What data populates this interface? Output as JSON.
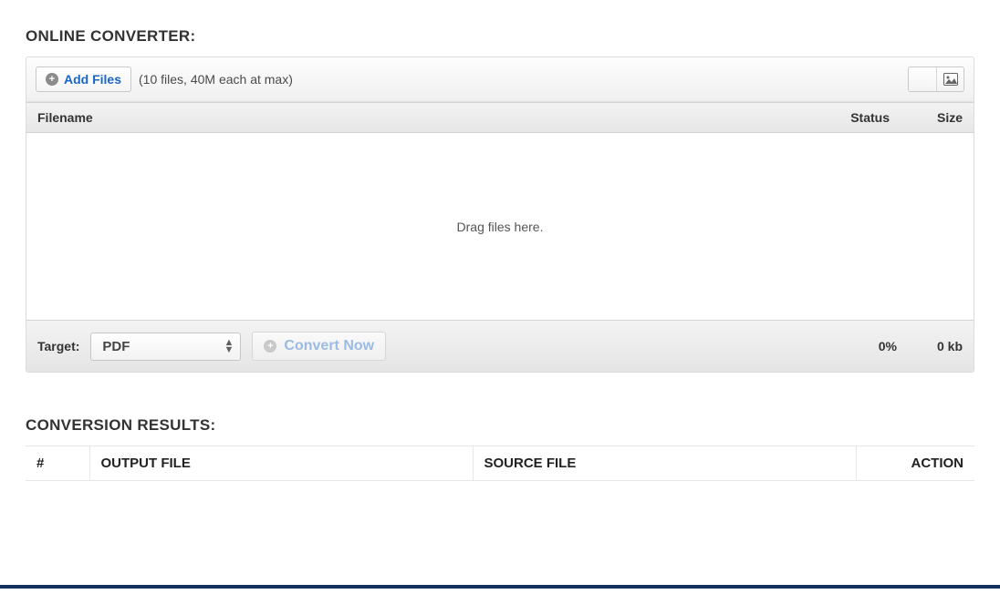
{
  "converter": {
    "title": "ONLINE CONVERTER:",
    "addFilesLabel": "Add Files",
    "limits": "(10 files, 40M each at max)",
    "columns": {
      "filename": "Filename",
      "status": "Status",
      "size": "Size"
    },
    "dropText": "Drag files here.",
    "targetLabel": "Target:",
    "targetValue": "PDF",
    "convertLabel": "Convert Now",
    "progress": "0%",
    "totalSize": "0 kb"
  },
  "results": {
    "title": "CONVERSION RESULTS:",
    "columns": {
      "num": "#",
      "output": "OUTPUT FILE",
      "source": "SOURCE FILE",
      "action": "ACTION"
    }
  },
  "icons": {
    "plus": "+",
    "image": "image-icon"
  }
}
